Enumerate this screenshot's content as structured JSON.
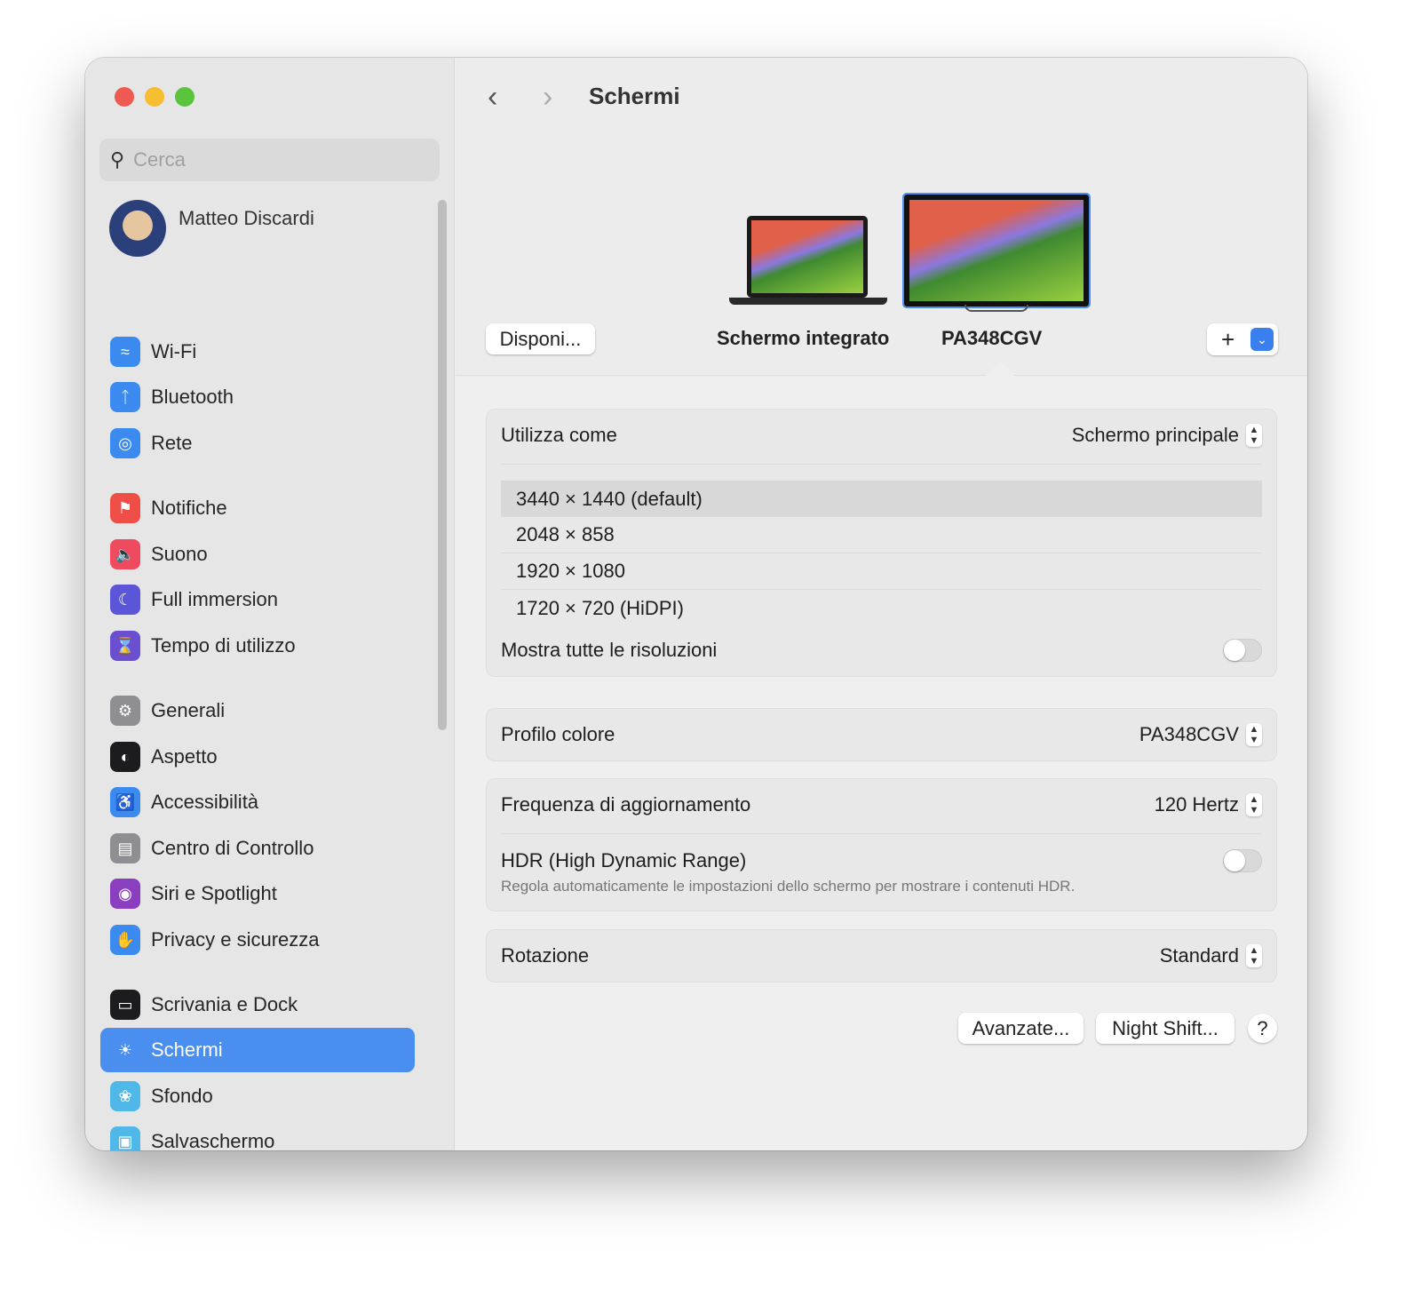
{
  "window": {
    "title": "Schermi"
  },
  "sidebar": {
    "search_placeholder": "Cerca",
    "user_name": "Matteo Discardi",
    "items": [
      {
        "label": "Wi-Fi",
        "icon": "wifi-icon",
        "color": "#3a8af0"
      },
      {
        "label": "Bluetooth",
        "icon": "bluetooth-icon",
        "color": "#3a8af0"
      },
      {
        "label": "Rete",
        "icon": "globe-icon",
        "color": "#3a8af0"
      },
      {
        "label": "Notifiche",
        "icon": "bell-icon",
        "color": "#ef4e46"
      },
      {
        "label": "Suono",
        "icon": "speaker-icon",
        "color": "#ef4a5e"
      },
      {
        "label": "Full immersion",
        "icon": "moon-icon",
        "color": "#5b55d8"
      },
      {
        "label": "Tempo di utilizzo",
        "icon": "hourglass-icon",
        "color": "#6a4fd0"
      },
      {
        "label": "Generali",
        "icon": "gear-icon",
        "color": "#8e8e93"
      },
      {
        "label": "Aspetto",
        "icon": "appearance-icon",
        "color": "#1c1c1e"
      },
      {
        "label": "Accessibilità",
        "icon": "accessibility-icon",
        "color": "#3a8af0"
      },
      {
        "label": "Centro di Controllo",
        "icon": "control-center-icon",
        "color": "#8e8e93"
      },
      {
        "label": "Siri e Spotlight",
        "icon": "siri-icon",
        "color": "#8a3fc0"
      },
      {
        "label": "Privacy e sicurezza",
        "icon": "hand-icon",
        "color": "#3a8af0"
      },
      {
        "label": "Scrivania e Dock",
        "icon": "dock-icon",
        "color": "#1c1c1e"
      },
      {
        "label": "Schermi",
        "icon": "sun-icon",
        "color": "#3a8af0"
      },
      {
        "label": "Sfondo",
        "icon": "flower-icon",
        "color": "#4fb8e8"
      },
      {
        "label": "Salvaschermo",
        "icon": "screensaver-icon",
        "color": "#4fb8e8"
      }
    ],
    "selected": "Schermi"
  },
  "displays": {
    "arrange_button": "Disponi...",
    "built_in": "Schermo integrato",
    "external": "PA348CGV",
    "add": "+",
    "selected": "PA348CGV"
  },
  "settings": {
    "use_as_label": "Utilizza come",
    "use_as_value": "Schermo principale",
    "resolutions": [
      "3440 × 1440 (default)",
      "2048 × 858",
      "1920 × 1080",
      "1720 × 720 (HiDPI)"
    ],
    "selected_resolution": "3440 × 1440 (default)",
    "show_all_label": "Mostra tutte le risoluzioni",
    "show_all": false,
    "color_profile_label": "Profilo colore",
    "color_profile_value": "PA348CGV",
    "refresh_label": "Frequenza di aggiornamento",
    "refresh_value": "120 Hertz",
    "hdr_label": "HDR (High Dynamic Range)",
    "hdr_desc": "Regola automaticamente le impostazioni dello schermo per mostrare i contenuti HDR.",
    "hdr": false,
    "rotation_label": "Rotazione",
    "rotation_value": "Standard"
  },
  "footer": {
    "advanced": "Avanzate...",
    "night_shift": "Night Shift...",
    "help": "?"
  }
}
